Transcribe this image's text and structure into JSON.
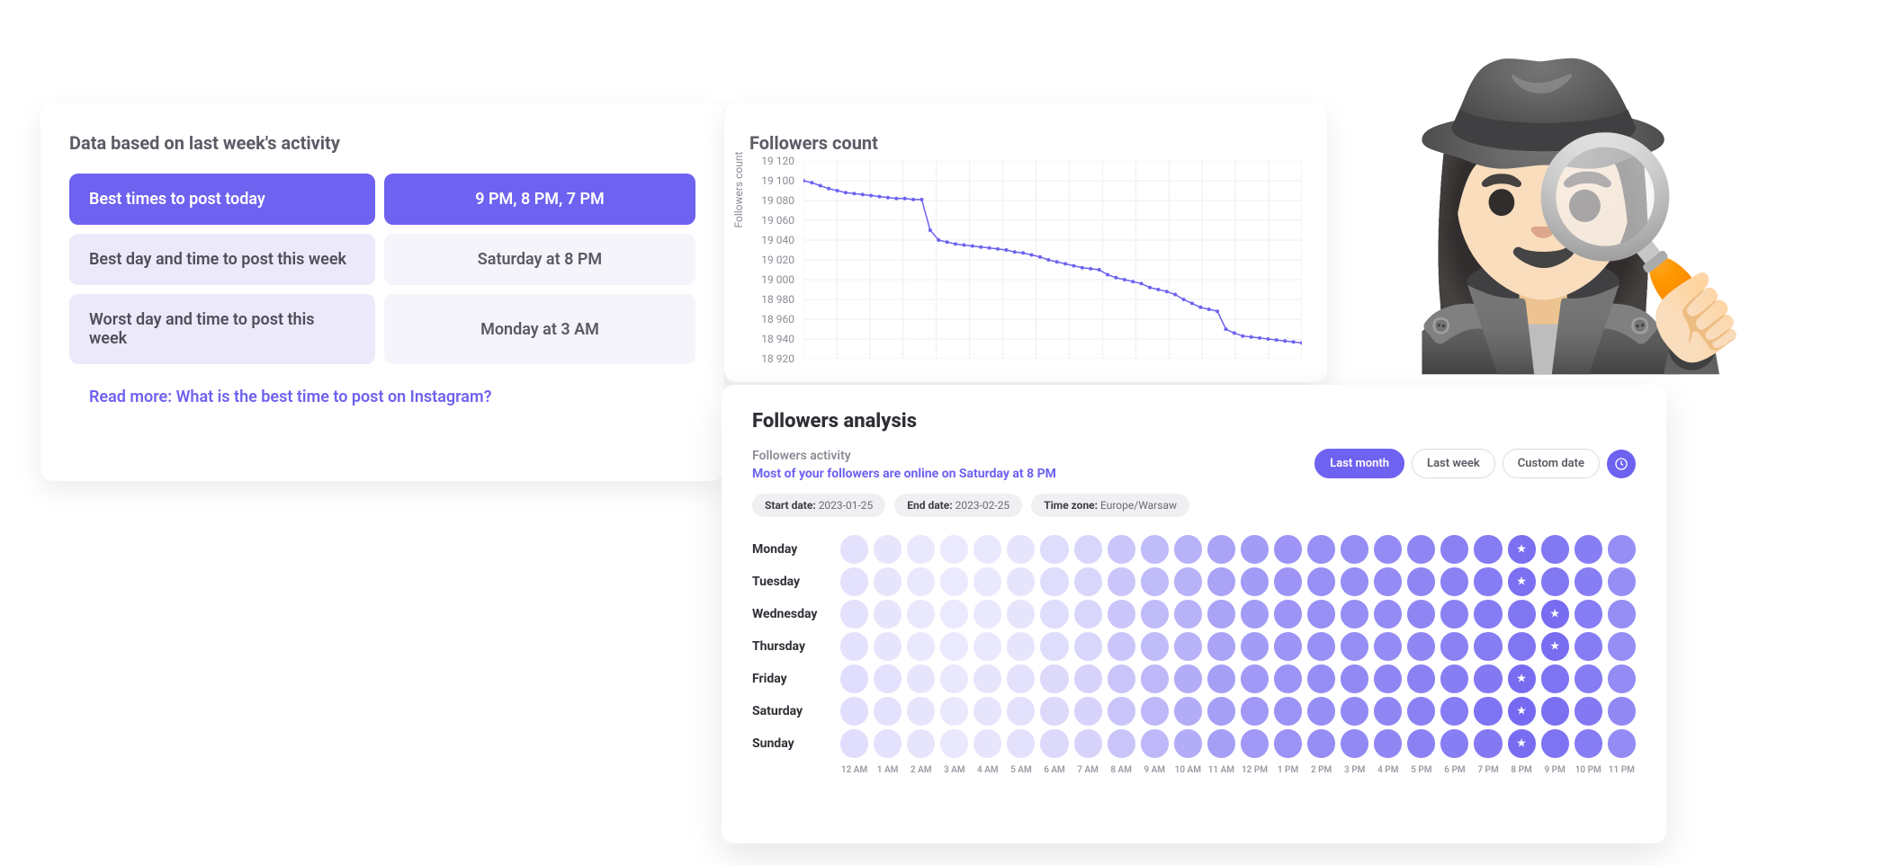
{
  "card1": {
    "title": "Data based on last week's activity",
    "rows": [
      {
        "label": "Best times to post today",
        "value": "9 PM, 8 PM, 7 PM",
        "primary": true
      },
      {
        "label": "Best day and time to post this week",
        "value": "Saturday at 8 PM",
        "primary": false
      },
      {
        "label": "Worst day and time to post this week",
        "value": "Monday at 3 AM",
        "primary": false
      }
    ],
    "readmore_prefix": "Read more: ",
    "readmore_link": "What is the best time to post on Instagram?"
  },
  "card2": {
    "title": "Followers count",
    "ylabel": "Followers count"
  },
  "chart_data": {
    "type": "line",
    "title": "Followers count",
    "ylabel": "Followers count",
    "ylim": [
      18920,
      19120
    ],
    "yticks": [
      18920,
      18940,
      18960,
      18980,
      19000,
      19020,
      19040,
      19060,
      19080,
      19100,
      19120
    ],
    "x": [
      0,
      1,
      2,
      3,
      4,
      5,
      6,
      7,
      8,
      9,
      10,
      11,
      12,
      13,
      14,
      15,
      16,
      17,
      18,
      19,
      20,
      21,
      22,
      23,
      24,
      25,
      26,
      27,
      28,
      29,
      30,
      31,
      32,
      33,
      34,
      35,
      36,
      37,
      38,
      39,
      40,
      41,
      42,
      43,
      44,
      45,
      46,
      47,
      48,
      49,
      50,
      51,
      52,
      53,
      54,
      55,
      56,
      57,
      58,
      59
    ],
    "values": [
      19100,
      19098,
      19095,
      19092,
      19090,
      19088,
      19087,
      19086,
      19085,
      19084,
      19083,
      19082,
      19082,
      19081,
      19081,
      19050,
      19040,
      19038,
      19036,
      19035,
      19034,
      19033,
      19032,
      19031,
      19030,
      19028,
      19027,
      19025,
      19023,
      19020,
      19018,
      19016,
      19014,
      19012,
      19011,
      19010,
      19005,
      19002,
      19000,
      18998,
      18996,
      18992,
      18990,
      18988,
      18985,
      18980,
      18976,
      18972,
      18970,
      18968,
      18950,
      18946,
      18943,
      18942,
      18941,
      18940,
      18939,
      18938,
      18937,
      18936
    ]
  },
  "card3": {
    "title": "Followers analysis",
    "activity_label": "Followers activity",
    "activity_value": "Most of your followers are online on Saturday at 8 PM",
    "buttons": {
      "last_month": "Last month",
      "last_week": "Last week",
      "custom": "Custom date"
    },
    "chips": {
      "start_label": "Start date:",
      "start_value": "2023-01-25",
      "end_label": "End date:",
      "end_value": "2023-02-25",
      "tz_label": "Time zone:",
      "tz_value": "Europe/Warsaw"
    },
    "days": [
      "Monday",
      "Tuesday",
      "Wednesday",
      "Thursday",
      "Friday",
      "Saturday",
      "Sunday"
    ],
    "hours": [
      "12 AM",
      "1 AM",
      "2 AM",
      "3 AM",
      "4 AM",
      "5 AM",
      "6 AM",
      "7 AM",
      "8 AM",
      "9 AM",
      "10 AM",
      "11 AM",
      "12 PM",
      "1 PM",
      "2 PM",
      "3 PM",
      "4 PM",
      "5 PM",
      "6 PM",
      "7 PM",
      "8 PM",
      "9 PM",
      "10 PM",
      "11 PM"
    ],
    "heatmap": [
      [
        0.12,
        0.1,
        0.08,
        0.07,
        0.08,
        0.1,
        0.15,
        0.2,
        0.3,
        0.38,
        0.45,
        0.55,
        0.6,
        0.65,
        0.68,
        0.7,
        0.72,
        0.75,
        0.78,
        0.82,
        0.9,
        0.85,
        0.8,
        0.7
      ],
      [
        0.12,
        0.1,
        0.08,
        0.07,
        0.08,
        0.1,
        0.15,
        0.2,
        0.3,
        0.38,
        0.45,
        0.55,
        0.6,
        0.65,
        0.68,
        0.7,
        0.72,
        0.75,
        0.78,
        0.82,
        0.9,
        0.85,
        0.8,
        0.7
      ],
      [
        0.12,
        0.1,
        0.08,
        0.07,
        0.08,
        0.1,
        0.15,
        0.2,
        0.3,
        0.38,
        0.45,
        0.55,
        0.6,
        0.65,
        0.68,
        0.7,
        0.72,
        0.75,
        0.78,
        0.82,
        0.86,
        0.92,
        0.82,
        0.7
      ],
      [
        0.12,
        0.1,
        0.08,
        0.07,
        0.08,
        0.1,
        0.15,
        0.2,
        0.3,
        0.38,
        0.45,
        0.55,
        0.6,
        0.65,
        0.68,
        0.7,
        0.72,
        0.75,
        0.78,
        0.82,
        0.86,
        0.92,
        0.82,
        0.7
      ],
      [
        0.14,
        0.12,
        0.1,
        0.08,
        0.1,
        0.12,
        0.17,
        0.22,
        0.32,
        0.4,
        0.48,
        0.58,
        0.62,
        0.66,
        0.7,
        0.73,
        0.75,
        0.78,
        0.8,
        0.84,
        0.92,
        0.88,
        0.82,
        0.72
      ],
      [
        0.14,
        0.12,
        0.1,
        0.08,
        0.1,
        0.12,
        0.17,
        0.22,
        0.32,
        0.4,
        0.48,
        0.58,
        0.62,
        0.66,
        0.7,
        0.73,
        0.75,
        0.78,
        0.82,
        0.88,
        0.95,
        0.9,
        0.84,
        0.74
      ],
      [
        0.14,
        0.12,
        0.1,
        0.08,
        0.1,
        0.12,
        0.17,
        0.22,
        0.32,
        0.4,
        0.48,
        0.58,
        0.62,
        0.66,
        0.7,
        0.73,
        0.75,
        0.78,
        0.8,
        0.84,
        0.92,
        0.88,
        0.82,
        0.72
      ]
    ],
    "peaks": [
      20,
      20,
      21,
      21,
      20,
      20,
      20
    ]
  }
}
